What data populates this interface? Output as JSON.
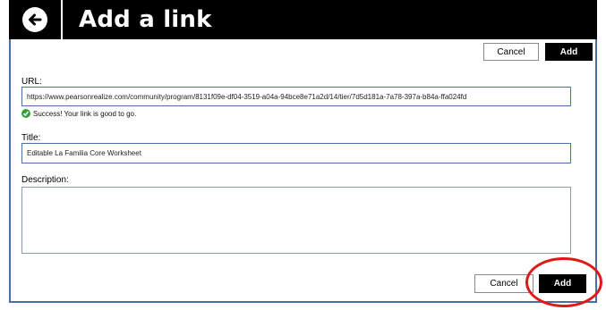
{
  "header": {
    "title": "Add a link",
    "back_icon": "arrow-left-icon"
  },
  "top_actions": {
    "cancel_label": "Cancel",
    "add_label": "Add"
  },
  "form": {
    "url": {
      "label": "URL:",
      "value": "https://www.pearsonrealize.com/community/program/8131f09e-df04-3519-a04a-94bce8e71a2d/14/tier/7d5d181a-7a78-397a-b84a-ffa024fd"
    },
    "validation": {
      "message": "Success! Your link is good to go.",
      "status_color": "#33a13a"
    },
    "title": {
      "label": "Title:",
      "value": "Editable La Familia Core Worksheet"
    },
    "description": {
      "label": "Description:",
      "value": ""
    }
  },
  "bottom_actions": {
    "cancel_label": "Cancel",
    "add_label": "Add"
  },
  "colors": {
    "header_bg": "#000000",
    "border_blue": "#4a6fa8",
    "highlight_red": "#e01818"
  }
}
